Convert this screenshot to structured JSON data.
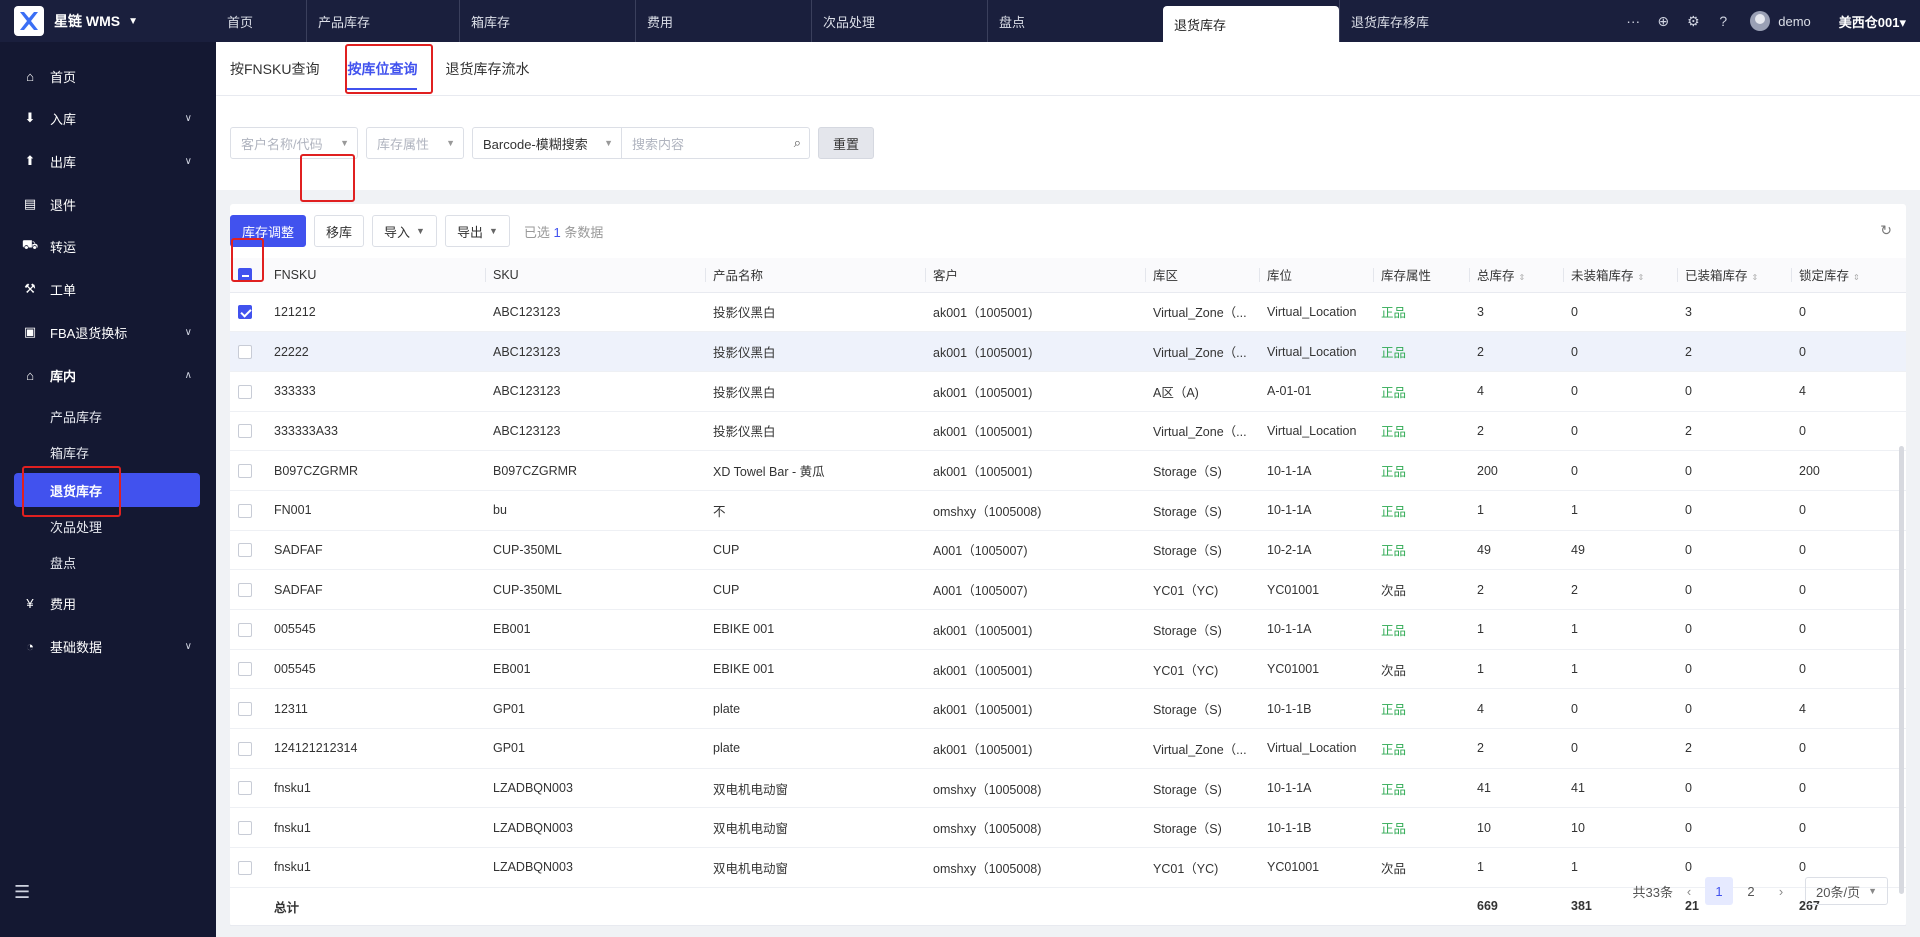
{
  "brand": {
    "name": "星链 WMS"
  },
  "top_tabs": [
    "首页",
    "产品库存",
    "箱库存",
    "费用",
    "次品处理",
    "盘点",
    "退货库存",
    "退货库存移库"
  ],
  "top_right": {
    "more": "···",
    "user": "demo",
    "warehouse": "美西仓001"
  },
  "sidebar": {
    "items": [
      {
        "label": "首页",
        "icon": "home-icon"
      },
      {
        "label": "入库",
        "icon": "inbound-icon"
      },
      {
        "label": "出库",
        "icon": "outbound-icon"
      },
      {
        "label": "退件",
        "icon": "return-icon"
      },
      {
        "label": "转运",
        "icon": "truck-icon"
      },
      {
        "label": "工单",
        "icon": "workorder-icon"
      },
      {
        "label": "FBA退货换标",
        "icon": "fba-icon"
      },
      {
        "label": "库内",
        "icon": "warehouse-icon"
      },
      {
        "label": "费用",
        "icon": "fee-icon"
      },
      {
        "label": "基础数据",
        "icon": "pie-icon"
      }
    ],
    "subitems": [
      "产品库存",
      "箱库存",
      "退货库存",
      "次品处理",
      "盘点"
    ]
  },
  "sub_tabs": [
    "按FNSKU查询",
    "按库位查询",
    "退货库存流水"
  ],
  "filters": {
    "customer_placeholder": "客户名称/代码",
    "attr_placeholder": "库存属性",
    "search_mode": "Barcode-模糊搜索",
    "search_placeholder": "搜索内容",
    "reset": "重置"
  },
  "toolbar": {
    "adjust": "库存调整",
    "move": "移库",
    "import": "导入",
    "export": "导出",
    "selected_prefix": "已选",
    "selected_count": "1",
    "selected_suffix": "条数据"
  },
  "table": {
    "headers": [
      "FNSKU",
      "SKU",
      "产品名称",
      "客户",
      "库区",
      "库位",
      "库存属性",
      "总库存",
      "未装箱库存",
      "已装箱库存",
      "锁定库存"
    ],
    "rows": [
      {
        "checked": true,
        "fnsku": "121212",
        "sku": "ABC123123",
        "name": "投影仪黑白",
        "customer": "ak001（1005001)",
        "zone": "Virtual_Zone（...",
        "loc": "Virtual_Location",
        "attr": "正品",
        "total": "3",
        "unboxed": "0",
        "boxed": "3",
        "locked": "0"
      },
      {
        "checked": false,
        "fnsku": "22222",
        "sku": "ABC123123",
        "name": "投影仪黑白",
        "customer": "ak001（1005001)",
        "zone": "Virtual_Zone（...",
        "loc": "Virtual_Location",
        "attr": "正品",
        "total": "2",
        "unboxed": "0",
        "boxed": "2",
        "locked": "0"
      },
      {
        "checked": false,
        "fnsku": "333333",
        "sku": "ABC123123",
        "name": "投影仪黑白",
        "customer": "ak001（1005001)",
        "zone": "A区（A)",
        "loc": "A-01-01",
        "attr": "正品",
        "total": "4",
        "unboxed": "0",
        "boxed": "0",
        "locked": "4"
      },
      {
        "checked": false,
        "fnsku": "333333A33",
        "sku": "ABC123123",
        "name": "投影仪黑白",
        "customer": "ak001（1005001)",
        "zone": "Virtual_Zone（...",
        "loc": "Virtual_Location",
        "attr": "正品",
        "total": "2",
        "unboxed": "0",
        "boxed": "2",
        "locked": "0"
      },
      {
        "checked": false,
        "fnsku": "B097CZGRMR",
        "sku": "B097CZGRMR",
        "name": "XD Towel Bar - 黄瓜",
        "customer": "ak001（1005001)",
        "zone": "Storage（S)",
        "loc": "10-1-1A",
        "attr": "正品",
        "total": "200",
        "unboxed": "0",
        "boxed": "0",
        "locked": "200"
      },
      {
        "checked": false,
        "fnsku": "FN001",
        "sku": "bu",
        "name": "不",
        "customer": "omshxy（1005008)",
        "zone": "Storage（S)",
        "loc": "10-1-1A",
        "attr": "正品",
        "total": "1",
        "unboxed": "1",
        "boxed": "0",
        "locked": "0"
      },
      {
        "checked": false,
        "fnsku": "SADFAF",
        "sku": "CUP-350ML",
        "name": "CUP",
        "customer": "A001（1005007)",
        "zone": "Storage（S)",
        "loc": "10-2-1A",
        "attr": "正品",
        "total": "49",
        "unboxed": "49",
        "boxed": "0",
        "locked": "0"
      },
      {
        "checked": false,
        "fnsku": "SADFAF",
        "sku": "CUP-350ML",
        "name": "CUP",
        "customer": "A001（1005007)",
        "zone": "YC01（YC)",
        "loc": "YC01001",
        "attr": "次品",
        "total": "2",
        "unboxed": "2",
        "boxed": "0",
        "locked": "0"
      },
      {
        "checked": false,
        "fnsku": "005545",
        "sku": "EB001",
        "name": "EBIKE 001",
        "customer": "ak001（1005001)",
        "zone": "Storage（S)",
        "loc": "10-1-1A",
        "attr": "正品",
        "total": "1",
        "unboxed": "1",
        "boxed": "0",
        "locked": "0"
      },
      {
        "checked": false,
        "fnsku": "005545",
        "sku": "EB001",
        "name": "EBIKE 001",
        "customer": "ak001（1005001)",
        "zone": "YC01（YC)",
        "loc": "YC01001",
        "attr": "次品",
        "total": "1",
        "unboxed": "1",
        "boxed": "0",
        "locked": "0"
      },
      {
        "checked": false,
        "fnsku": "12311",
        "sku": "GP01",
        "name": "plate",
        "customer": "ak001（1005001)",
        "zone": "Storage（S)",
        "loc": "10-1-1B",
        "attr": "正品",
        "total": "4",
        "unboxed": "0",
        "boxed": "0",
        "locked": "4"
      },
      {
        "checked": false,
        "fnsku": "124121212314",
        "sku": "GP01",
        "name": "plate",
        "customer": "ak001（1005001)",
        "zone": "Virtual_Zone（...",
        "loc": "Virtual_Location",
        "attr": "正品",
        "total": "2",
        "unboxed": "0",
        "boxed": "2",
        "locked": "0"
      },
      {
        "checked": false,
        "fnsku": "fnsku1",
        "sku": "LZADBQN003",
        "name": "双电机电动窗",
        "customer": "omshxy（1005008)",
        "zone": "Storage（S)",
        "loc": "10-1-1A",
        "attr": "正品",
        "total": "41",
        "unboxed": "41",
        "boxed": "0",
        "locked": "0"
      },
      {
        "checked": false,
        "fnsku": "fnsku1",
        "sku": "LZADBQN003",
        "name": "双电机电动窗",
        "customer": "omshxy（1005008)",
        "zone": "Storage（S)",
        "loc": "10-1-1B",
        "attr": "正品",
        "total": "10",
        "unboxed": "10",
        "boxed": "0",
        "locked": "0"
      },
      {
        "checked": false,
        "fnsku": "fnsku1",
        "sku": "LZADBQN003",
        "name": "双电机电动窗",
        "customer": "omshxy（1005008)",
        "zone": "YC01（YC)",
        "loc": "YC01001",
        "attr": "次品",
        "total": "1",
        "unboxed": "1",
        "boxed": "0",
        "locked": "0"
      }
    ],
    "total": {
      "label": "总计",
      "total": "669",
      "unboxed": "381",
      "boxed": "21",
      "locked": "267"
    }
  },
  "pager": {
    "summary": "共33条",
    "pages": [
      "1",
      "2"
    ],
    "page_size": "20条/页"
  },
  "colors": {
    "accent": "#4152ee",
    "nav_bg": "#1a1f3d",
    "good": "#2faa53",
    "highlight": "#e02020"
  }
}
